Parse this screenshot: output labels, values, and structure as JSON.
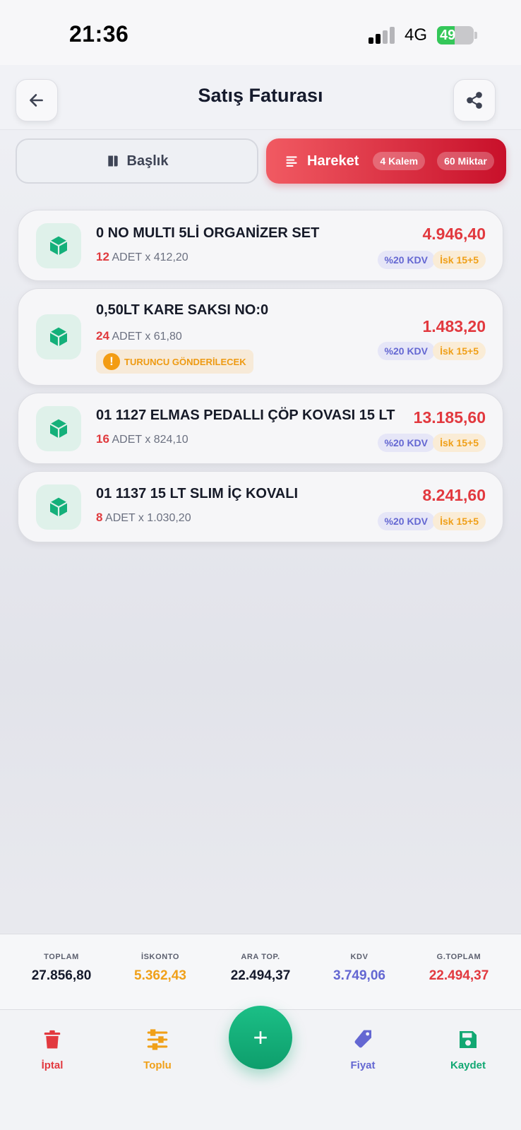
{
  "status_bar": {
    "time": "21:36",
    "network": "4G",
    "battery": "49",
    "battery_level": 0.49
  },
  "header": {
    "title": "Satış Faturası"
  },
  "tabs": {
    "baslik": {
      "label": "Başlık"
    },
    "hareket": {
      "label": "Hareket",
      "badge_kalem": "4 Kalem",
      "badge_miktar": "60 Miktar"
    }
  },
  "items": [
    {
      "name": "0 NO MULTI 5Lİ ORGANİZER SET",
      "qty": "12",
      "unit_price": "ADET x 412,20",
      "total": "4.946,40",
      "kdv": "%20 KDV",
      "isk": "İsk 15+5"
    },
    {
      "name": "0,50LT KARE SAKSI NO:0",
      "qty": "24",
      "unit_price": "ADET x 61,80",
      "note": "TURUNCU GÖNDERİLECEK",
      "total": "1.483,20",
      "kdv": "%20 KDV",
      "isk": "İsk 15+5"
    },
    {
      "name": "01 1127 ELMAS PEDALLI ÇÖP KOVASI 15 LT",
      "qty": "16",
      "unit_price": "ADET x 824,10",
      "total": "13.185,60",
      "kdv": "%20 KDV",
      "isk": "İsk 15+5"
    },
    {
      "name": "01 1137 15 LT SLIM İÇ KOVALI",
      "qty": "8",
      "unit_price": "ADET x 1.030,20",
      "total": "8.241,60",
      "kdv": "%20 KDV",
      "isk": "İsk 15+5"
    }
  ],
  "totals": {
    "toplam": {
      "label": "TOPLAM",
      "value": "27.856,80",
      "color": "#151a2c"
    },
    "iskonto": {
      "label": "İSKONTO",
      "value": "5.362,43",
      "color": "#f0a019"
    },
    "ara_top": {
      "label": "ARA TOP.",
      "value": "22.494,37",
      "color": "#151a2c"
    },
    "kdv": {
      "label": "KDV",
      "value": "3.749,06",
      "color": "#6467d2"
    },
    "g_toplam": {
      "label": "G.TOPLAM",
      "value": "22.494,37",
      "color": "#e2393f"
    }
  },
  "bottom_nav": {
    "iptal": {
      "label": "İptal",
      "icon": "trash-icon",
      "color": "#e2393f"
    },
    "toplu": {
      "label": "Toplu",
      "icon": "sliders-icon",
      "color": "#f0a019"
    },
    "add": {
      "label": "+",
      "icon": "plus-icon",
      "color": "#12a873"
    },
    "fiyat": {
      "label": "Fiyat",
      "icon": "tag-icon",
      "color": "#6467d2"
    },
    "kaydet": {
      "label": "Kaydet",
      "icon": "save-icon",
      "color": "#12a873"
    }
  }
}
